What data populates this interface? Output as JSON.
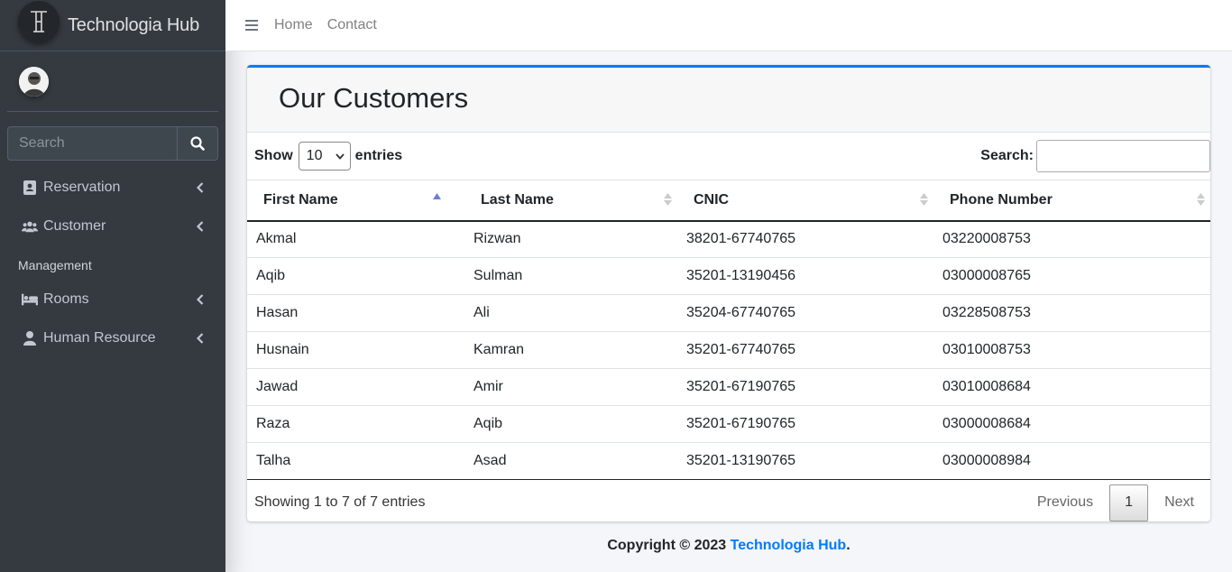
{
  "brand": {
    "name": "Technologia Hub",
    "logo_text": "TH"
  },
  "sidebar": {
    "search_placeholder": "Search",
    "items": [
      {
        "label": "Reservation",
        "icon": "id-card-icon"
      },
      {
        "label": "Customer",
        "icon": "users-icon"
      }
    ],
    "header": "Management",
    "items2": [
      {
        "label": "Rooms",
        "icon": "bed-icon"
      },
      {
        "label": "Human Resource",
        "icon": "user-icon"
      }
    ]
  },
  "topbar": {
    "links": [
      "Home",
      "Contact"
    ]
  },
  "card": {
    "title": "Our Customers",
    "show_label": "Show",
    "entries_value": "10",
    "entries_label": "entries",
    "search_label": "Search:",
    "columns": [
      "First Name",
      "Last Name",
      "CNIC",
      "Phone Number"
    ],
    "rows": [
      [
        "Akmal",
        "Rizwan",
        "38201-67740765",
        "03220008753"
      ],
      [
        "Aqib",
        "Sulman",
        "35201-13190456",
        "03000008765"
      ],
      [
        "Hasan",
        "Ali",
        "35204-67740765",
        "03228508753"
      ],
      [
        "Husnain",
        "Kamran",
        "35201-67740765",
        "03010008753"
      ],
      [
        "Jawad",
        "Amir",
        "35201-67190765",
        "03010008684"
      ],
      [
        "Raza",
        "Aqib",
        "35201-67190765",
        "03000008684"
      ],
      [
        "Talha",
        "Asad",
        "35201-13190765",
        "03000008984"
      ]
    ],
    "info": "Showing 1 to 7 of 7 entries",
    "pagination": {
      "previous": "Previous",
      "current": "1",
      "next": "Next"
    }
  },
  "footer": {
    "prefix": "Copyright © 2023 ",
    "link": "Technologia Hub",
    "suffix": "."
  },
  "colors": {
    "accent": "#007bff",
    "sidebar": "#343a40"
  }
}
